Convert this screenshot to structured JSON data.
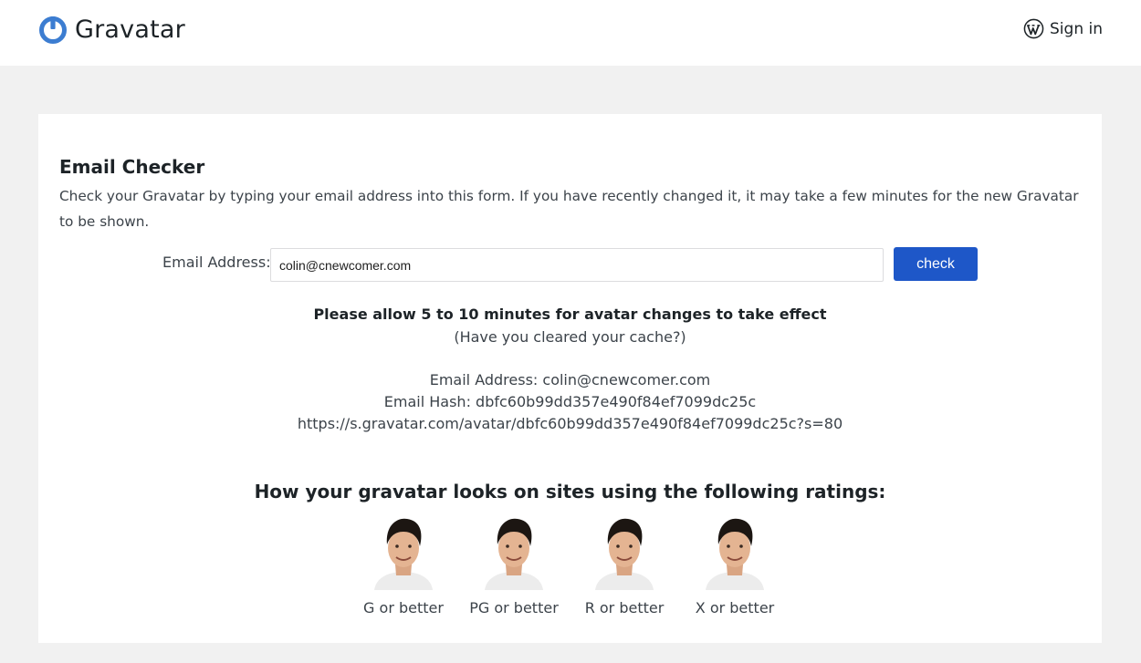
{
  "header": {
    "brand_name": "Gravatar",
    "signin_label": "Sign in"
  },
  "colors": {
    "brand_blue": "#1e57c8",
    "logo_blue": "#3c7dd1",
    "page_bg": "#f1f1f1"
  },
  "checker": {
    "title": "Email Checker",
    "intro": "Check your Gravatar by typing your email address into this form. If you have recently changed it, it may take a few minutes for the new Gravatar to be shown.",
    "email_label": "Email Address:",
    "email_value": "colin@cnewcomer.com",
    "check_label": "check"
  },
  "results": {
    "notice": "Please allow 5 to 10 minutes for avatar changes to take effect",
    "cache_hint": "(Have you cleared your cache?)",
    "email_line": "Email Address: colin@cnewcomer.com",
    "hash_line": "Email Hash: dbfc60b99dd357e490f84ef7099dc25c",
    "url_line": "https://s.gravatar.com/avatar/dbfc60b99dd357e490f84ef7099dc25c?s=80"
  },
  "ratings": {
    "heading": "How your gravatar looks on sites using the following ratings:",
    "items": [
      {
        "label": "G or better"
      },
      {
        "label": "PG or better"
      },
      {
        "label": "R or better"
      },
      {
        "label": "X or better"
      }
    ]
  },
  "icons": {
    "logo": "gravatar-logo-icon",
    "signin": "wordpress-icon",
    "avatar": "avatar-photo"
  }
}
